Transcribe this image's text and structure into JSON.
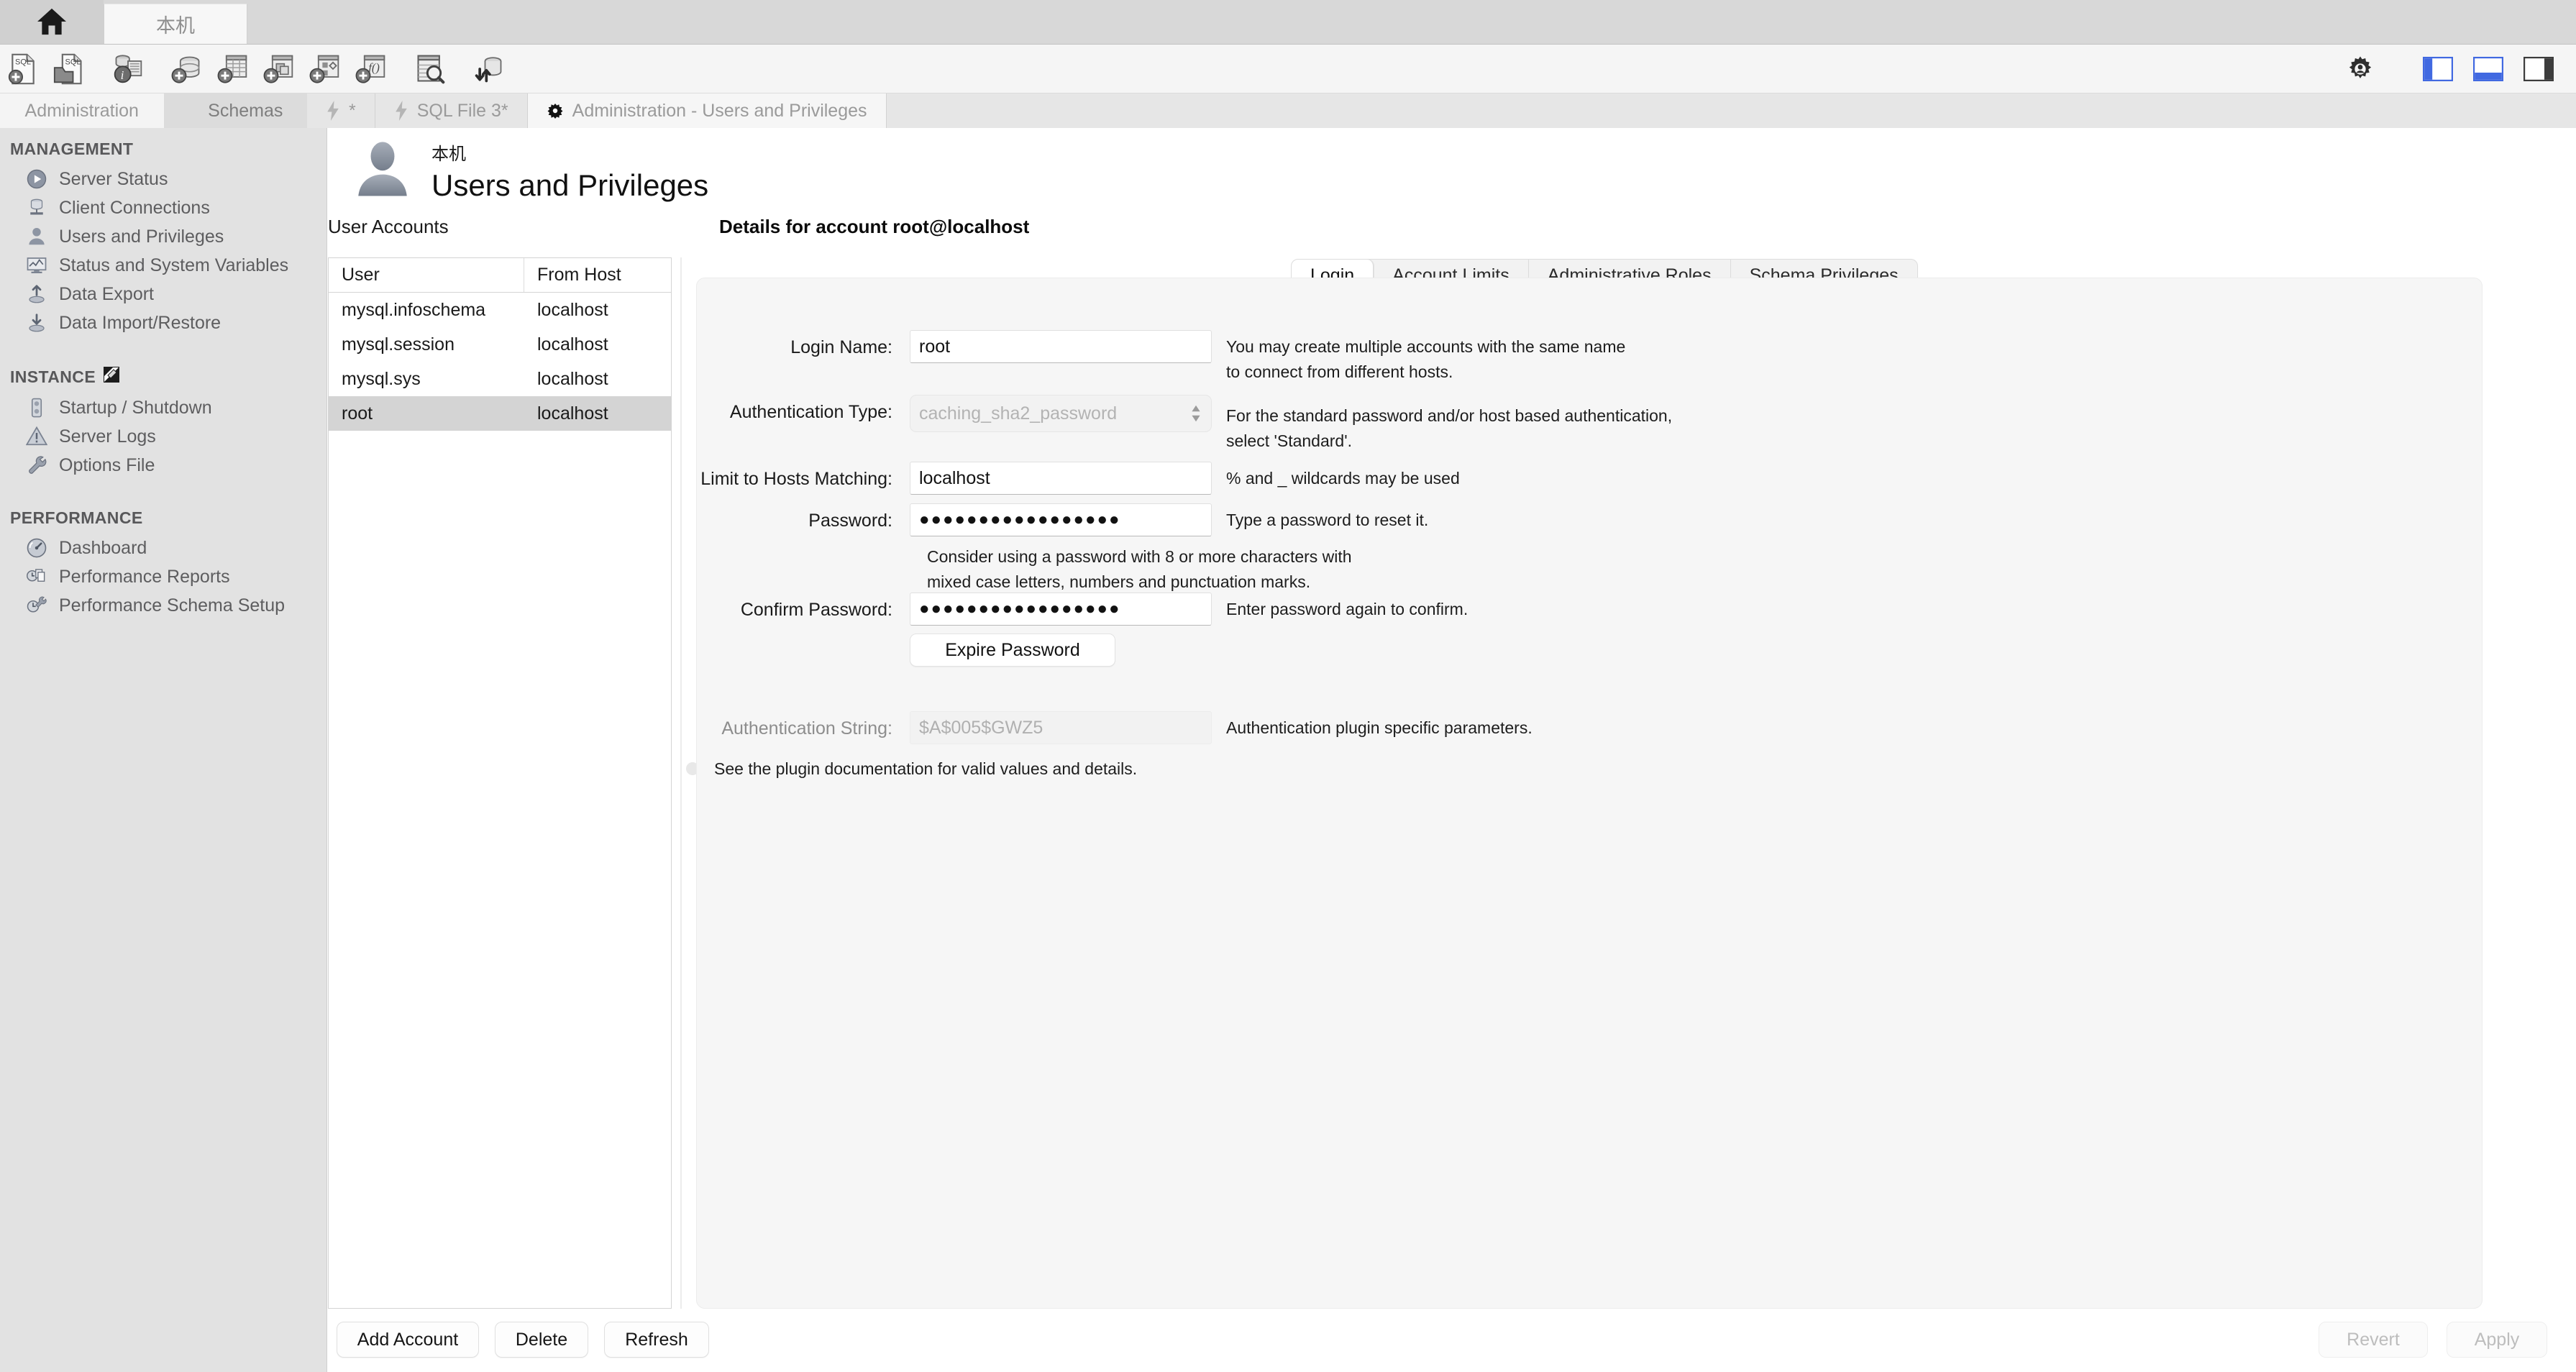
{
  "window": {
    "connection_tab": "本机",
    "home_tab_icon": "home-icon"
  },
  "toolbar": {
    "items": [
      {
        "icon": "new-sql-tab-icon",
        "label": "Create a new SQL tab for executing queries"
      },
      {
        "icon": "open-sql-script-icon",
        "label": "Open a SQL script file in a new query tab"
      },
      {
        "icon": "inspector-icon",
        "label": "Open Inspector for the selected object"
      },
      {
        "icon": "new-schema-icon",
        "label": "Create a new schema in the connected server"
      },
      {
        "icon": "new-table-icon",
        "label": "Create a new table in the active schema"
      },
      {
        "icon": "new-view-icon",
        "label": "Create a new view in the active schema"
      },
      {
        "icon": "new-procedure-icon",
        "label": "Create a new stored procedure in the active schema"
      },
      {
        "icon": "new-function-icon",
        "label": "Create a new function in the active schema"
      },
      {
        "icon": "search-data-icon",
        "label": "Search table data"
      },
      {
        "icon": "reconnect-icon",
        "label": "Reconnect to DBMS"
      }
    ],
    "right_items": [
      {
        "icon": "gear-icon",
        "label": "Preferences"
      },
      {
        "icon": "toggle-sidebar-icon",
        "label": "Show/Hide Sidebar"
      },
      {
        "icon": "toggle-output-icon",
        "label": "Show/Hide Output Area"
      },
      {
        "icon": "toggle-secondary-sidebar-icon",
        "label": "Show/Hide Secondary Sidebar"
      }
    ]
  },
  "sidebar_tabs": [
    {
      "label": "Administration",
      "active": true
    },
    {
      "label": "Schemas",
      "active": false
    }
  ],
  "editor_tabs": [
    {
      "label": "*",
      "icon": "lightning-icon",
      "active": false
    },
    {
      "label": "SQL File 3*",
      "icon": "lightning-icon",
      "active": false
    },
    {
      "label": "Administration - Users and Privileges",
      "icon": "admin-gear-icon",
      "active": true
    }
  ],
  "sidebar": {
    "sections": [
      {
        "title": "MANAGEMENT",
        "badge": null,
        "items": [
          {
            "label": "Server Status",
            "icon": "server-status-icon",
            "selected": false
          },
          {
            "label": "Client Connections",
            "icon": "client-connections-icon",
            "selected": false
          },
          {
            "label": "Users and Privileges",
            "icon": "users-privileges-icon",
            "selected": true
          },
          {
            "label": "Status and System Variables",
            "icon": "status-variables-icon",
            "selected": false
          },
          {
            "label": "Data Export",
            "icon": "data-export-icon",
            "selected": false
          },
          {
            "label": "Data Import/Restore",
            "icon": "data-import-icon",
            "selected": false
          }
        ]
      },
      {
        "title": "INSTANCE",
        "badge": "instance-badge-icon",
        "items": [
          {
            "label": "Startup / Shutdown",
            "icon": "startup-shutdown-icon",
            "selected": false
          },
          {
            "label": "Server Logs",
            "icon": "server-logs-icon",
            "selected": false
          },
          {
            "label": "Options File",
            "icon": "options-file-icon",
            "selected": false
          }
        ]
      },
      {
        "title": "PERFORMANCE",
        "badge": null,
        "items": [
          {
            "label": "Dashboard",
            "icon": "dashboard-icon",
            "selected": false
          },
          {
            "label": "Performance Reports",
            "icon": "perf-reports-icon",
            "selected": false
          },
          {
            "label": "Performance Schema Setup",
            "icon": "perf-schema-setup-icon",
            "selected": false
          }
        ]
      }
    ]
  },
  "page": {
    "server_name": "本机",
    "title": "Users and Privileges",
    "avatar_icon": "user-avatar-icon"
  },
  "accounts_panel": {
    "label": "User Accounts",
    "columns": [
      "User",
      "From Host"
    ],
    "rows": [
      {
        "user": "mysql.infoschema",
        "host": "localhost",
        "selected": false
      },
      {
        "user": "mysql.session",
        "host": "localhost",
        "selected": false
      },
      {
        "user": "mysql.sys",
        "host": "localhost",
        "selected": false
      },
      {
        "user": "root",
        "host": "localhost",
        "selected": true
      }
    ]
  },
  "details": {
    "heading": "Details for account root@localhost",
    "tabs": [
      {
        "label": "Login",
        "active": true
      },
      {
        "label": "Account Limits",
        "active": false
      },
      {
        "label": "Administrative Roles",
        "active": false
      },
      {
        "label": "Schema Privileges",
        "active": false
      }
    ],
    "fields": {
      "login_name": {
        "label": "Login Name:",
        "value": "root",
        "hint_line1": "You may create multiple accounts with the same name",
        "hint_line2": "to connect from different hosts."
      },
      "auth_type": {
        "label": "Authentication Type:",
        "value": "caching_sha2_password",
        "hint_line1": "For the standard password and/or host based authentication,",
        "hint_line2": "select 'Standard'."
      },
      "limit_hosts": {
        "label": "Limit to Hosts Matching:",
        "value": "localhost",
        "hint_line1": "% and _ wildcards may be used"
      },
      "password": {
        "label": "Password:",
        "value": "●●●●●●●●●●●●●●●●●",
        "hint_line1": "Type a password to reset it.",
        "note_line1": "Consider using a password with 8 or more characters with",
        "note_line2": "mixed case letters, numbers and punctuation marks."
      },
      "confirm_password": {
        "label": "Confirm Password:",
        "value": "●●●●●●●●●●●●●●●●●",
        "hint_line1": "Enter password again to confirm."
      },
      "expire_password_button": "Expire Password",
      "auth_string": {
        "label": "Authentication String:",
        "value": "$A$005$GWZ5",
        "hint_line1": "Authentication plugin specific parameters."
      },
      "plugin_doc_note": "See the plugin documentation for valid values and details."
    }
  },
  "footer": {
    "add_account": "Add Account",
    "delete": "Delete",
    "refresh": "Refresh",
    "revert": "Revert",
    "apply": "Apply"
  },
  "colors": {
    "accent_blue": "#4169e1",
    "sidebar_bg": "#e2e2e2",
    "panel_bg": "#f6f6f6",
    "selected_row": "#d4d4d4"
  }
}
